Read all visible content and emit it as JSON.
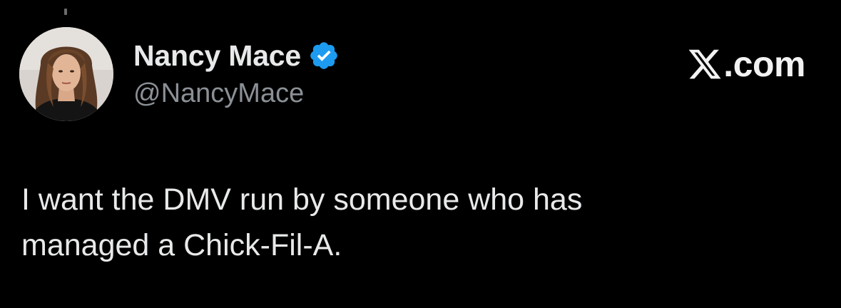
{
  "author": {
    "display_name": "Nancy Mace",
    "handle": "@NancyMace",
    "verified": true,
    "avatar_icon": "profile-photo",
    "verified_icon": "verified-badge-icon"
  },
  "brand": {
    "logo_icon": "x-logo-icon",
    "domain_suffix": ".com"
  },
  "tweet": {
    "text": "I want the DMV run by someone who has\nmanaged a Chick-Fil-A."
  },
  "colors": {
    "background": "#000000",
    "text_primary": "#e7e9ea",
    "text_secondary": "#8b9096",
    "verified_blue": "#1d9bf0"
  }
}
